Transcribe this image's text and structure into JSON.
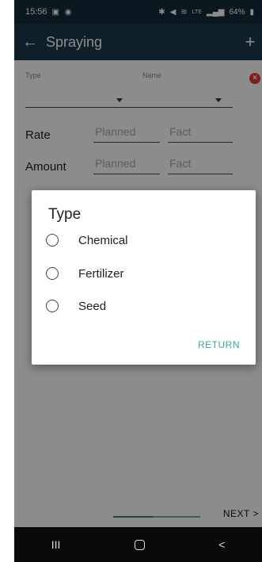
{
  "status_bar": {
    "time": "15:56",
    "battery": "64%",
    "left_icons": [
      "gallery-icon",
      "messenger-icon"
    ],
    "right_icons": [
      "bluetooth-icon",
      "mute-icon",
      "wifi-icon",
      "signal-icon"
    ],
    "network_tag": "LTE"
  },
  "app_bar": {
    "title": "Spraying",
    "back_icon": "arrow-left-icon",
    "add_icon": "plus-icon"
  },
  "form": {
    "type_label": "Type",
    "name_label": "Name",
    "rate_label": "Rate",
    "amount_label": "Amount",
    "rate_planned_placeholder": "Planned",
    "rate_fact_placeholder": "Fact",
    "amount_planned_placeholder": "Planned",
    "amount_fact_placeholder": "Fact",
    "delete_icon": "remove-icon"
  },
  "dialog": {
    "title": "Type",
    "options": [
      {
        "label": "Chemical",
        "selected": false
      },
      {
        "label": "Fertilizer",
        "selected": false
      },
      {
        "label": "Seed",
        "selected": false
      }
    ],
    "return_label": "RETURN"
  },
  "pager": {
    "next_label": "NEXT >"
  },
  "system_nav": {
    "recent": "III",
    "home": "home-icon",
    "back": "<"
  },
  "colors": {
    "appbar": "#1c3a4d",
    "statusbar": "#142a38",
    "accent": "#3aa89a",
    "delete": "#e53935"
  }
}
